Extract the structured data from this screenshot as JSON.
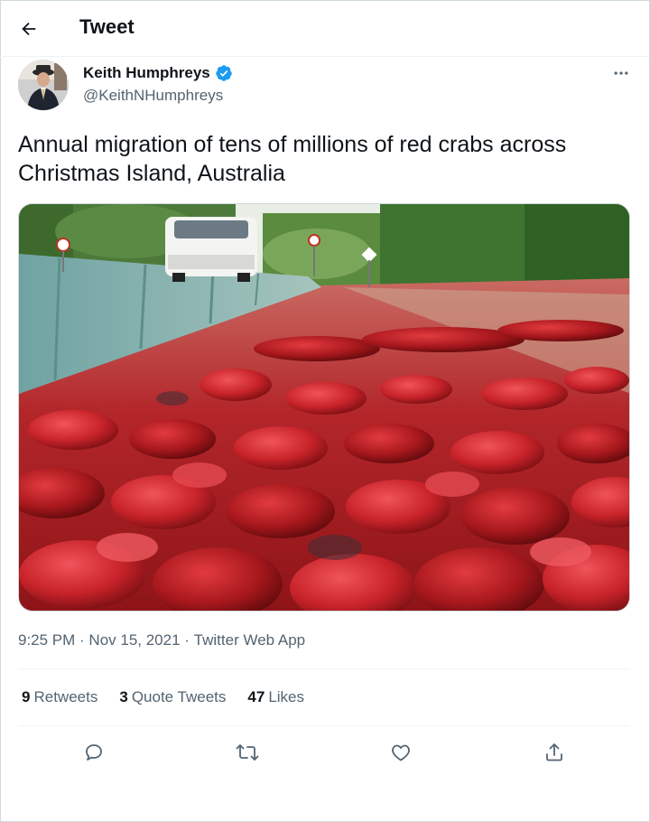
{
  "header": {
    "back_icon": "arrow-left-icon",
    "title": "Tweet"
  },
  "author": {
    "name": "Keith Humphreys",
    "verified": true,
    "handle": "@KeithNHumphreys",
    "more_icon": "more-horizontal-icon"
  },
  "tweet": {
    "text_line1": "Annual migration of tens of millions of red crabs across",
    "text_line2": "Christmas Island, Australia"
  },
  "meta": {
    "time": "9:25 PM",
    "sep1": " · ",
    "date": "Nov 15, 2021",
    "sep2": " · ",
    "source": "Twitter Web App"
  },
  "stats": {
    "retweets_count": "9",
    "retweets_label": "Retweets",
    "quotes_count": "3",
    "quotes_label": "Quote Tweets",
    "likes_count": "47",
    "likes_label": "Likes"
  },
  "actions": [
    "reply-icon",
    "retweet-icon",
    "like-icon",
    "share-icon"
  ],
  "colors": {
    "accent": "#1d9bf0",
    "text": "#0f1419",
    "secondary": "#536471",
    "border": "#eff3f4",
    "crab_red": "#c8232a"
  }
}
